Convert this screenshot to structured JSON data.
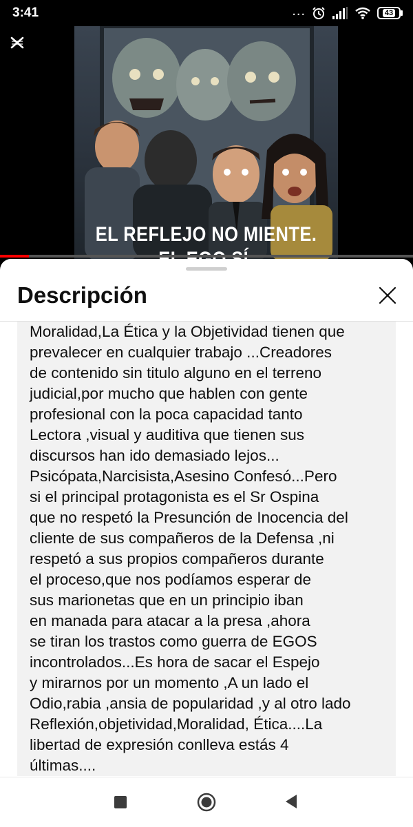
{
  "status_bar": {
    "time": "3:41",
    "more_indicator": "...",
    "battery_level": "43",
    "icons": [
      "more-dots-icon",
      "alarm-icon",
      "signal-icon",
      "wifi-icon",
      "battery-icon"
    ]
  },
  "video": {
    "caption_line_1": "EL REFLEJO NO MIENTE.",
    "caption_line_2": "EL EGO SÍ.",
    "progress": 0.07,
    "progress_color": "#ff0000"
  },
  "sheet": {
    "title": "Descripción",
    "close_icon": "close-icon",
    "description_lines": [
      "Moralidad,La Ética y la Objetividad tienen que",
      "prevalecer en cualquier trabajo ...Creadores",
      "de contenido sin titulo alguno en el terreno",
      "judicial,por mucho que hablen con gente",
      "profesional con la poca capacidad tanto",
      "Lectora ,visual y auditiva que tienen sus",
      "discursos han ido demasiado lejos...",
      "Psicópata,Narcisista,Asesino Confesó...Pero",
      "si el principal protagonista es el Sr Ospina",
      "que no respetó la Presunción de Inocencia del",
      "cliente de sus compañeros de la Defensa ,ni",
      "respetó a sus propios compañeros durante",
      "el proceso,que nos podíamos esperar de",
      "sus marionetas que en un principio iban",
      "en manada para atacar a la presa ,ahora",
      "se tiran los trastos como guerra de EGOS",
      "incontrolados...Es hora de sacar el Espejo",
      "y mirarnos por un momento ,A un lado el",
      "Odio,rabia ,ansia de popularidad ,y al otro lado",
      "Reflexión,objetividad,Moralidad, Ética....La",
      "libertad de expresión conlleva estás 4",
      "últimas...."
    ]
  },
  "nav_bar": {
    "icons": [
      "recents-square-icon",
      "home-circle-icon",
      "back-triangle-icon"
    ]
  },
  "colors": {
    "accent": "#ff0000",
    "sheet_bg": "#ffffff",
    "description_bg": "#f2f2f2",
    "text": "#0f0f0f"
  }
}
